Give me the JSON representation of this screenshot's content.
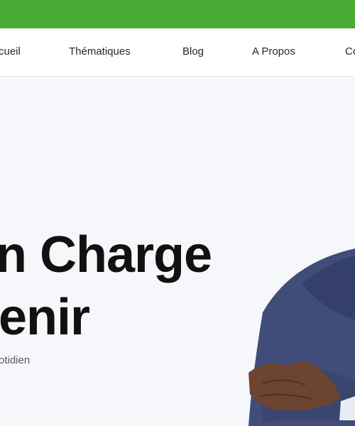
{
  "nav": {
    "items": [
      {
        "label": "cueil"
      },
      {
        "label": "Thématiques"
      },
      {
        "label": "Blog"
      },
      {
        "label": "A Propos"
      },
      {
        "label": "Co"
      }
    ]
  },
  "hero": {
    "line1": "n Charge",
    "line2": "enir",
    "subtitle": "otidien"
  },
  "colors": {
    "brand_green": "#4aab35",
    "heading": "#111111",
    "suit": "#3f4d78",
    "skin": "#6d4430"
  }
}
